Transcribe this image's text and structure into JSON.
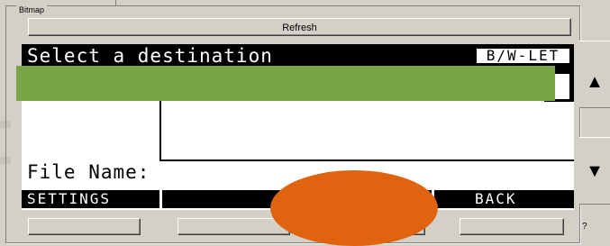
{
  "group": {
    "label": "Bitmap"
  },
  "toolbar": {
    "refresh_label": "Refresh"
  },
  "lcd": {
    "title": "Select a destination",
    "mode_badge": "B/W-LET",
    "filename_label": "File Name:",
    "softkeys": [
      "SETTINGS",
      "",
      "",
      "BACK"
    ]
  },
  "side": {
    "up_arrow": "▲",
    "down_arrow": "▼",
    "help_label": "?"
  },
  "colors": {
    "lcd_black": "#000000",
    "lcd_white": "#ffffff",
    "window_bg": "#d4d0c8",
    "redact_green": "#79a548",
    "redact_orange": "#e0640f"
  }
}
